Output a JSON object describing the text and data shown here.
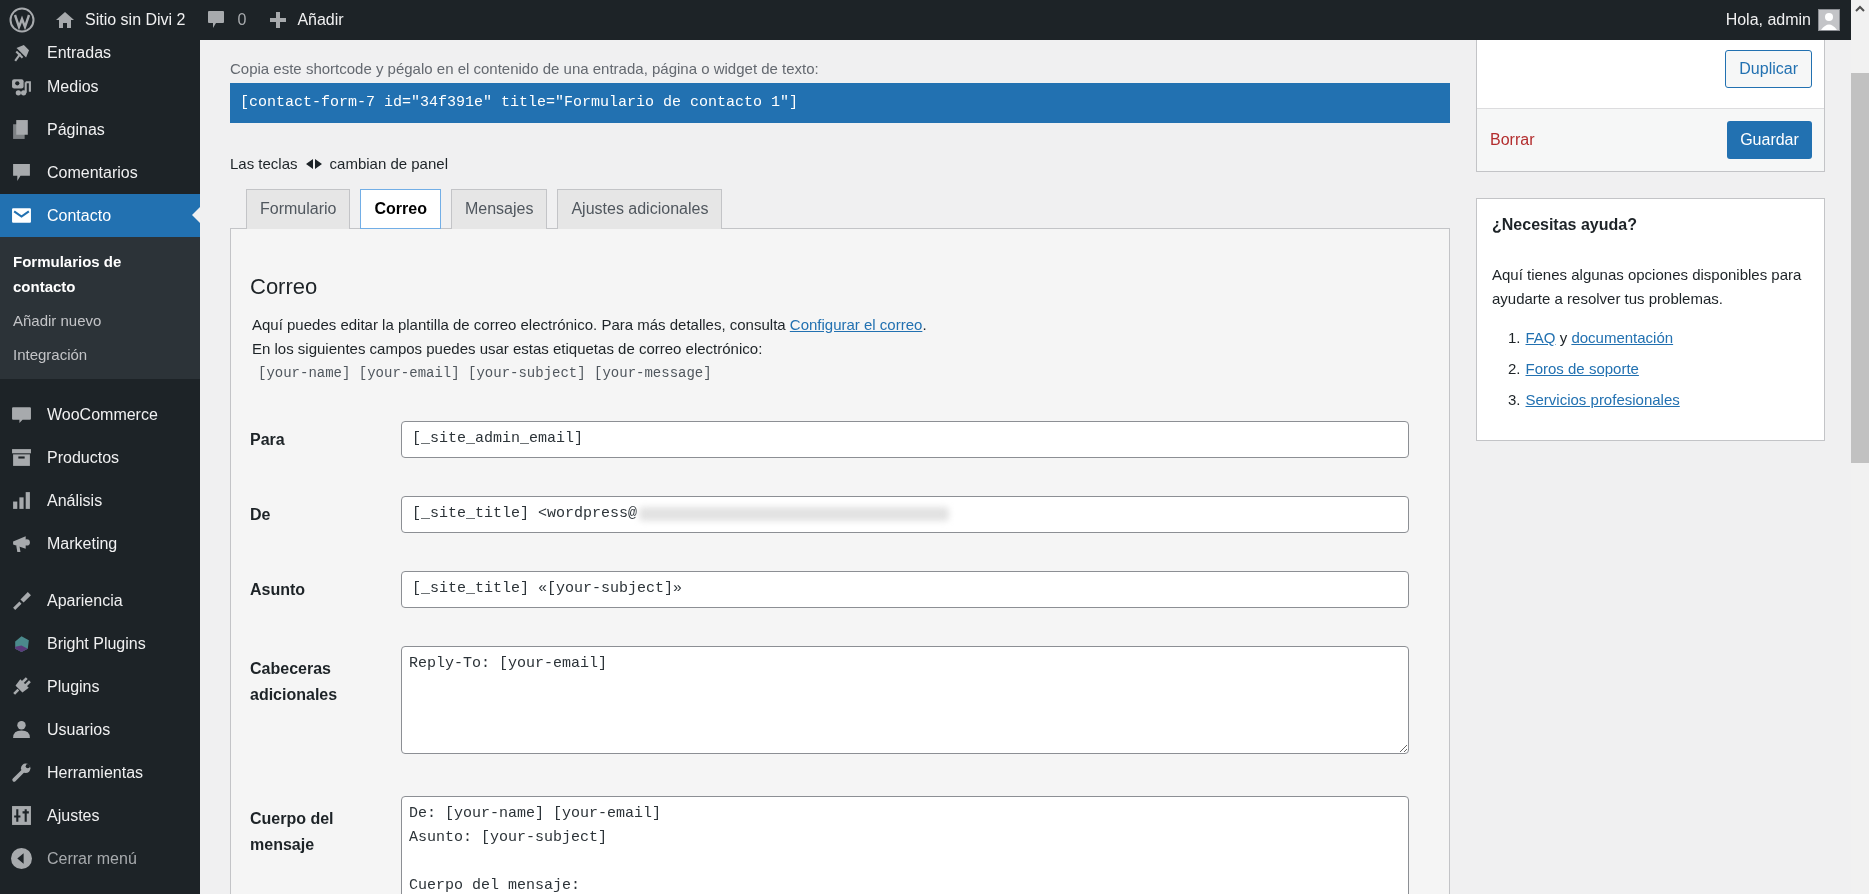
{
  "admin_bar": {
    "site_name": "Sitio sin Divi 2",
    "comments_count": "0",
    "new_label": "Añadir",
    "greeting": "Hola, admin"
  },
  "sidebar": {
    "groups": [
      [
        {
          "label": "Entradas",
          "selected": false
        },
        {
          "label": "Medios",
          "selected": false
        },
        {
          "label": "Páginas",
          "selected": false
        },
        {
          "label": "Comentarios",
          "selected": false
        },
        {
          "label": "Contacto",
          "selected": true,
          "children": [
            {
              "label": "Formularios de contacto",
              "selected": true
            },
            {
              "label": "Añadir nuevo",
              "selected": false
            },
            {
              "label": "Integración",
              "selected": false
            }
          ]
        }
      ],
      [
        {
          "label": "WooCommerce",
          "selected": false
        },
        {
          "label": "Productos",
          "selected": false
        },
        {
          "label": "Análisis",
          "selected": false
        },
        {
          "label": "Marketing",
          "selected": false
        }
      ],
      [
        {
          "label": "Apariencia",
          "selected": false
        },
        {
          "label": "Bright Plugins",
          "selected": false
        },
        {
          "label": "Plugins",
          "selected": false
        },
        {
          "label": "Usuarios",
          "selected": false
        },
        {
          "label": "Herramientas",
          "selected": false
        },
        {
          "label": "Ajustes",
          "selected": false
        }
      ]
    ],
    "collapse_label": "Cerrar menú"
  },
  "main": {
    "shortcode_hint": "Copia este shortcode y pégalo en el contenido de una entrada, página o widget de texto:",
    "shortcode": "[contact-form-7 id=\"34f391e\" title=\"Formulario de contacto 1\"]",
    "keys_hint_before": "Las teclas",
    "keys_hint_after": "cambian de panel",
    "tabs": [
      {
        "label": "Formulario",
        "selected": false
      },
      {
        "label": "Correo",
        "selected": true
      },
      {
        "label": "Mensajes",
        "selected": false
      },
      {
        "label": "Ajustes adicionales",
        "selected": false
      }
    ],
    "panel": {
      "heading": "Correo",
      "description": "Aquí puedes editar la plantilla de correo electrónico. Para más detalles, consulta ",
      "description_link": "Configurar el correo",
      "description_end": ".",
      "tags_hint": "En los siguientes campos puedes usar estas etiquetas de correo electrónico:",
      "tags": "[your-name] [your-email] [your-subject] [your-message]",
      "fields": [
        {
          "label": "Para",
          "kind": "input",
          "value": "[_site_admin_email]",
          "blurred": false
        },
        {
          "label": "De",
          "kind": "input",
          "value": "[_site_title] <wordpress@",
          "blurred": true
        },
        {
          "label": "Asunto",
          "kind": "input",
          "value": "[_site_title] «[your-subject]»",
          "blurred": false
        },
        {
          "label": "Cabeceras adicionales",
          "kind": "textarea",
          "value": "Reply-To: [your-email]",
          "blurred": false
        },
        {
          "label": "Cuerpo del mensaje",
          "kind": "textarea",
          "value": "De: [your-name] [your-email]\nAsunto: [your-subject]\n\nCuerpo del mensaje:",
          "blurred": false
        }
      ]
    }
  },
  "actions": {
    "duplicate_label": "Duplicar",
    "delete_label": "Borrar",
    "save_label": "Guardar"
  },
  "help": {
    "title": "¿Necesitas ayuda?",
    "text": "Aquí tienes algunas opciones disponibles para ayudarte a resolver tus problemas.",
    "items": [
      {
        "number": "1.",
        "parts": [
          {
            "text": "FAQ",
            "link": true
          },
          {
            "text": " y ",
            "link": false
          },
          {
            "text": "documentación",
            "link": true
          }
        ]
      },
      {
        "number": "2.",
        "parts": [
          {
            "text": "Foros de soporte",
            "link": true
          }
        ]
      },
      {
        "number": "3.",
        "parts": [
          {
            "text": "Servicios profesionales",
            "link": true
          }
        ]
      }
    ]
  }
}
